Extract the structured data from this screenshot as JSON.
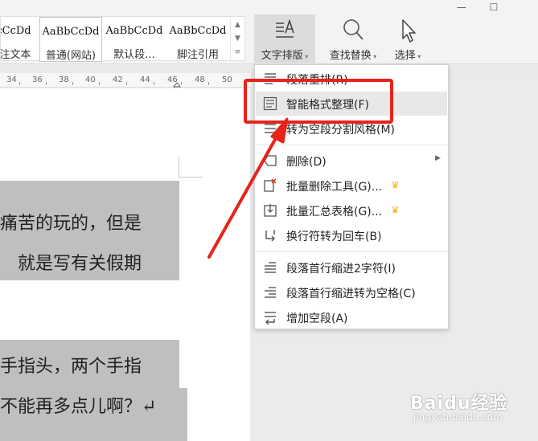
{
  "window": {
    "minimize_icon": "—",
    "maximize_icon": "☐"
  },
  "styles": [
    {
      "sample": "cCcDd",
      "name": "注文本"
    },
    {
      "sample": "AaBbCcDd",
      "name": "普通(网站)"
    },
    {
      "sample": "AaBbCcDd",
      "name": "默认段..."
    },
    {
      "sample": "AaBbCcDd",
      "name": "脚注引用"
    }
  ],
  "ribbon": {
    "text_layout": "文字排版",
    "find_replace": "查找替换",
    "select": "选择"
  },
  "ruler": {
    "labels": [
      "34",
      "36",
      "38",
      "40",
      "42",
      "44",
      "46",
      "48",
      "50"
    ]
  },
  "document": {
    "lines": [
      "痛苦的玩的，但是",
      "就是写有关假期",
      "手指头，两个手指",
      "不能再多点儿啊？↵"
    ]
  },
  "menu": {
    "items": [
      {
        "label": "段落重排(R)",
        "icon": "paragraph-rearrange-icon"
      },
      {
        "label": "智能格式整理(F)",
        "icon": "smart-format-icon"
      },
      {
        "label": "转为空段分割风格(M)",
        "icon": "empty-paragraph-icon"
      },
      {
        "label": "删除(D)",
        "icon": "delete-icon"
      },
      {
        "label": "批量删除工具(G)...",
        "icon": "batch-delete-icon"
      },
      {
        "label": "批量汇总表格(G)...",
        "icon": "batch-table-icon"
      },
      {
        "label": "换行符转为回车(B)",
        "icon": "line-break-icon"
      },
      {
        "label": "段落首行缩进2字符(I)",
        "icon": "indent-icon"
      },
      {
        "label": "段落首行缩进转为空格(C)",
        "icon": "indent-space-icon"
      },
      {
        "label": "增加空段(A)",
        "icon": "add-paragraph-icon"
      }
    ]
  },
  "watermark": {
    "main": "Baidu经验",
    "sub": "jingyan.baidu.com"
  },
  "colors": {
    "annotation_red": "#e5241a",
    "highlight_gray": "#bfbfbf",
    "crown": "#f2b51f"
  }
}
